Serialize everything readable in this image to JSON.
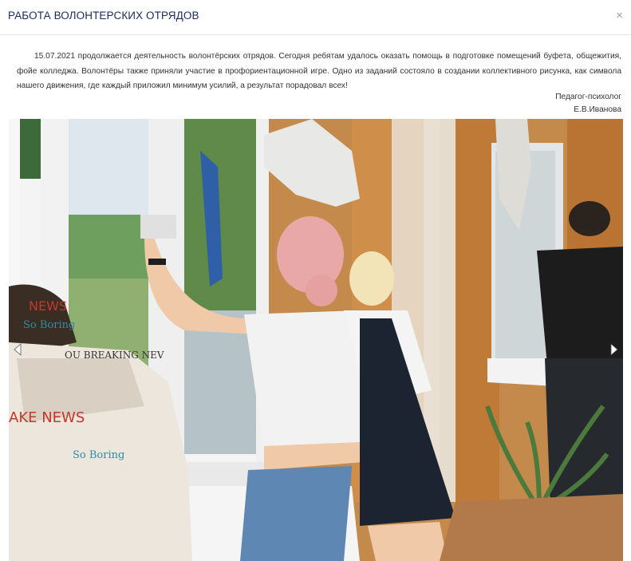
{
  "modal": {
    "title": "РАБОТА ВОЛОНТЕРСКИХ ОТРЯДОВ",
    "close_symbol": "×",
    "text": "15.07.2021 продолжается деятельность волонтёрских отрядов. Сегодня ребятам удалось оказать помощь в подготовке помещений буфета, общежития, фойе колледжа. Волонтёры также приняли участие в профориентационной игре. Одно из заданий состояло в создании коллективного рисунка, как символа нашего движения, где каждый приложил минимум усилий, а результат порадовал всех!",
    "signature_role": "Педагог-психолог",
    "signature_name": "Е.В.Иванова"
  },
  "gallery": {
    "prev_icon": "arrow-left-icon",
    "next_icon": "arrow-right-icon",
    "shirt_prints": [
      "NEWS",
      "So Boring",
      "OU BREAKING NEV",
      "AKE NEWS",
      "So Boring"
    ]
  },
  "colors": {
    "title": "#1d2b57",
    "text": "#333333",
    "curtain": "#c8843f",
    "window_frame": "#f2f2f2"
  }
}
